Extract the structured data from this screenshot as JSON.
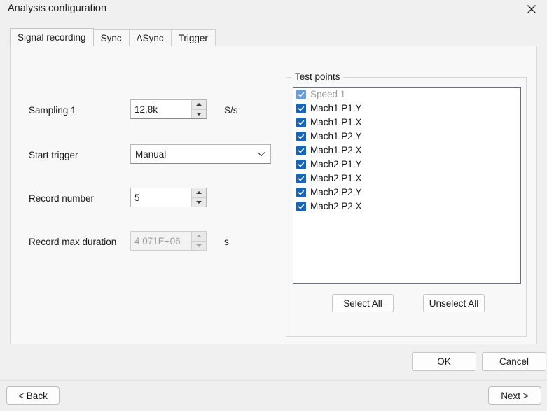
{
  "window": {
    "title": "Analysis configuration",
    "close_icon": "close-icon"
  },
  "tabs": [
    {
      "label": "Signal recording",
      "active": true
    },
    {
      "label": "Sync",
      "active": false
    },
    {
      "label": "ASync",
      "active": false
    },
    {
      "label": "Trigger",
      "active": false
    }
  ],
  "form": {
    "sampling": {
      "label": "Sampling 1",
      "value": "12.8k",
      "unit": "S/s",
      "enabled": true
    },
    "start_trigger": {
      "label": "Start trigger",
      "value": "Manual",
      "options": [
        "Manual"
      ]
    },
    "record_number": {
      "label": "Record number",
      "value": "5",
      "unit": "",
      "enabled": true
    },
    "record_max_duration": {
      "label": "Record max duration",
      "value": "4.071E+06",
      "unit": "s",
      "enabled": false
    }
  },
  "test_points": {
    "title": "Test points",
    "items": [
      {
        "label": "Speed 1",
        "checked": true,
        "enabled": false
      },
      {
        "label": "Mach1.P1.Y",
        "checked": true,
        "enabled": true
      },
      {
        "label": "Mach1.P1.X",
        "checked": true,
        "enabled": true
      },
      {
        "label": "Mach1.P2.Y",
        "checked": true,
        "enabled": true
      },
      {
        "label": "Mach1.P2.X",
        "checked": true,
        "enabled": true
      },
      {
        "label": "Mach2.P1.Y",
        "checked": true,
        "enabled": true
      },
      {
        "label": "Mach2.P1.X",
        "checked": true,
        "enabled": true
      },
      {
        "label": "Mach2.P2.Y",
        "checked": true,
        "enabled": true
      },
      {
        "label": "Mach2.P2.X",
        "checked": true,
        "enabled": true
      }
    ],
    "select_all_label": "Select All",
    "unselect_all_label": "Unselect All"
  },
  "dialog_buttons": {
    "ok_label": "OK",
    "cancel_label": "Cancel"
  },
  "wizard": {
    "back_label": "< Back",
    "next_label": "Next >"
  },
  "colors": {
    "checkbox_blue": "#1565c0",
    "window_bg": "#f0f0f0",
    "panel_bg": "#f8f8f8",
    "disabled_text": "#9b9b9b"
  }
}
